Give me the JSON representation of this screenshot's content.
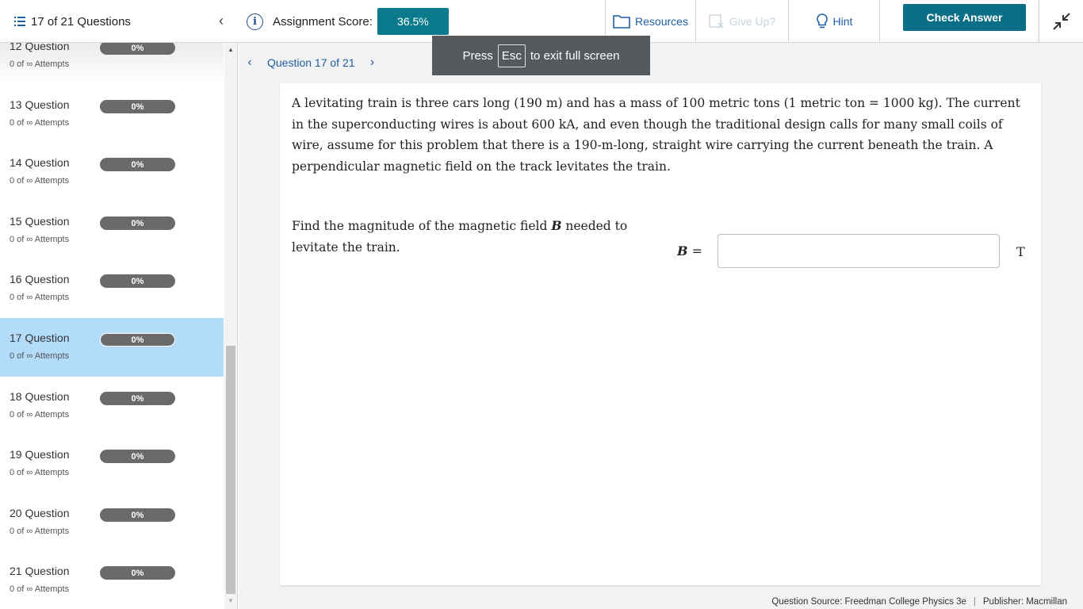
{
  "header": {
    "question_count": "17 of 21 Questions",
    "score_label": "Assignment Score:",
    "score_value": "36.5%",
    "resources_label": "Resources",
    "giveup_label": "Give Up?",
    "hint_label": "Hint",
    "check_answer_label": "Check Answer"
  },
  "sidebar": {
    "items": [
      {
        "title": "12 Question",
        "attempts": "0 of ∞ Attempts",
        "score": "0%"
      },
      {
        "title": "13 Question",
        "attempts": "0 of ∞ Attempts",
        "score": "0%"
      },
      {
        "title": "14 Question",
        "attempts": "0 of ∞ Attempts",
        "score": "0%"
      },
      {
        "title": "15 Question",
        "attempts": "0 of ∞ Attempts",
        "score": "0%"
      },
      {
        "title": "16 Question",
        "attempts": "0 of ∞ Attempts",
        "score": "0%"
      },
      {
        "title": "17 Question",
        "attempts": "0 of ∞ Attempts",
        "score": "0%"
      },
      {
        "title": "18 Question",
        "attempts": "0 of ∞ Attempts",
        "score": "0%"
      },
      {
        "title": "19 Question",
        "attempts": "0 of ∞ Attempts",
        "score": "0%"
      },
      {
        "title": "20 Question",
        "attempts": "0 of ∞ Attempts",
        "score": "0%"
      },
      {
        "title": "21 Question",
        "attempts": "0 of ∞ Attempts",
        "score": "0%"
      }
    ]
  },
  "nav": {
    "question_label": "Question 17 of 21"
  },
  "toast": {
    "press": "Press",
    "key": "Esc",
    "rest": "to exit full screen"
  },
  "question": {
    "body": "A levitating train is three cars long (190 m) and has a mass of 100 metric tons (1 metric ton = 1000 kg). The current in the superconducting wires is about 600 kA, and even though the traditional design calls for many small coils of wire, assume for this problem that there is a 190-m-long, straight wire carrying the current beneath the train. A perpendicular magnetic field on the track levitates the train.",
    "prompt_before": "Find the magnitude of the magnetic field ",
    "prompt_var": "B",
    "prompt_after": " needed to levitate the train.",
    "answer_var": "B",
    "answer_eq": " =",
    "answer_value": "",
    "unit": "T"
  },
  "footer": {
    "source": "Question Source: Freedman College Physics 3e",
    "publisher": "Publisher: Macmillan"
  },
  "colors": {
    "accent": "#0a7a8c",
    "link": "#1f5fa0",
    "active_item": "#b3dcfa"
  },
  "icons": {
    "list": "list-icon",
    "collapse": "chevron-left-icon",
    "info": "info-icon",
    "resources": "folder-icon",
    "giveup": "give-up-icon",
    "hint": "lightbulb-icon",
    "shrink": "exit-fullscreen-icon"
  }
}
